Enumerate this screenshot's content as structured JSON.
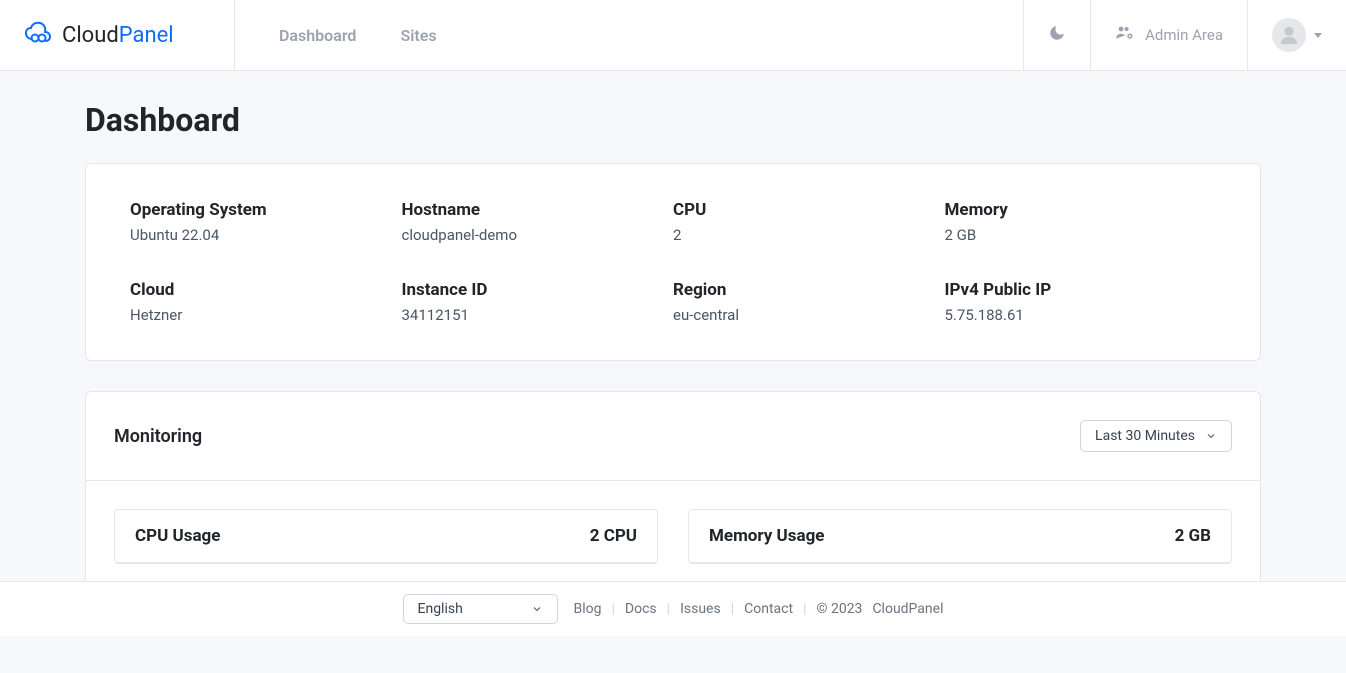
{
  "brand": {
    "part1": "Cloud",
    "part2": "Panel"
  },
  "nav": {
    "dashboard": "Dashboard",
    "sites": "Sites"
  },
  "admin_area": "Admin Area",
  "page_title": "Dashboard",
  "info": {
    "os_label": "Operating System",
    "os_value": "Ubuntu 22.04",
    "hostname_label": "Hostname",
    "hostname_value": "cloudpanel-demo",
    "cpu_label": "CPU",
    "cpu_value": "2",
    "memory_label": "Memory",
    "memory_value": "2 GB",
    "cloud_label": "Cloud",
    "cloud_value": "Hetzner",
    "instance_label": "Instance ID",
    "instance_value": "34112151",
    "region_label": "Region",
    "region_value": "eu-central",
    "ip_label": "IPv4 Public IP",
    "ip_value": "5.75.188.61"
  },
  "monitoring": {
    "title": "Monitoring",
    "timerange": "Last 30 Minutes",
    "cpu_usage_label": "CPU Usage",
    "cpu_usage_value": "2 CPU",
    "memory_usage_label": "Memory Usage",
    "memory_usage_value": "2 GB"
  },
  "footer": {
    "language": "English",
    "blog": "Blog",
    "docs": "Docs",
    "issues": "Issues",
    "contact": "Contact",
    "copyright": "© 2023",
    "brand": "CloudPanel"
  }
}
